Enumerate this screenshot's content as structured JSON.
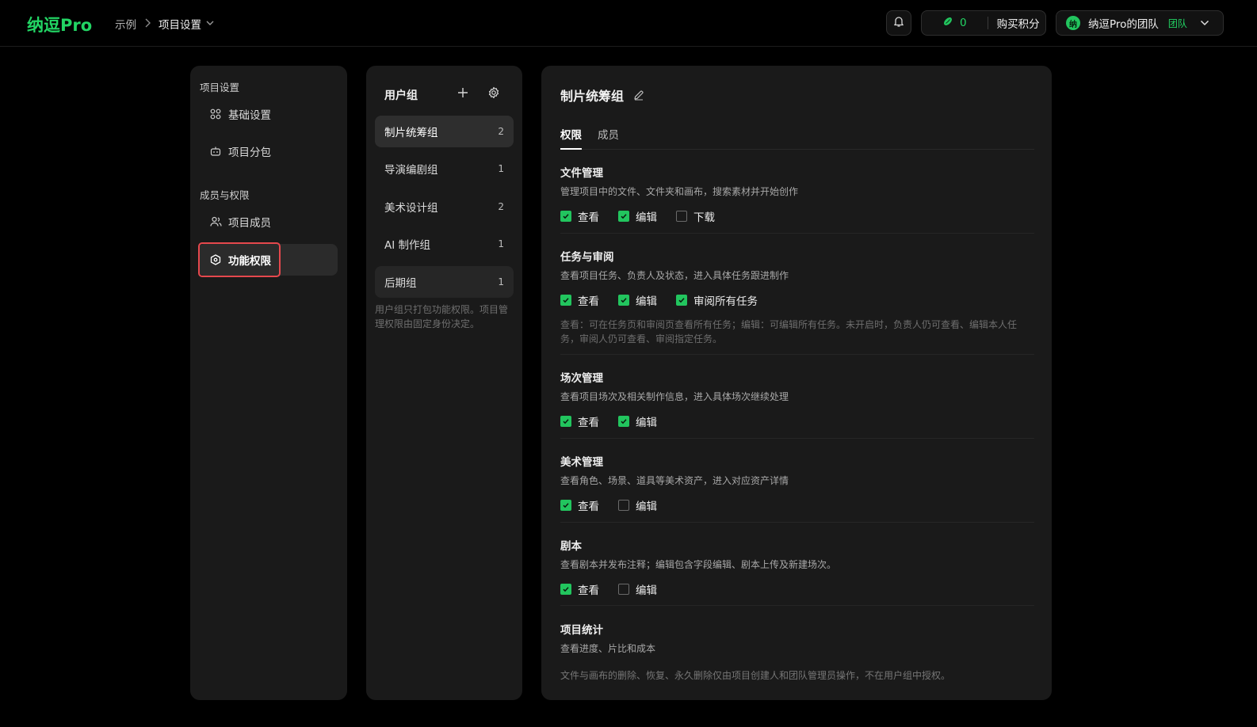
{
  "app": {
    "logo": "纳逗Pro"
  },
  "breadcrumb": {
    "root": "示例",
    "current": "项目设置"
  },
  "header": {
    "points_value": "0",
    "buy_label": "购买积分",
    "team_avatar": "纳",
    "team_name": "纳逗Pro的团队",
    "team_badge": "团队"
  },
  "sidebar": {
    "section1": "项目设置",
    "section2": "成员与权限",
    "items": [
      {
        "label": "基础设置",
        "icon": "grid-icon"
      },
      {
        "label": "项目分包",
        "icon": "robot-icon"
      },
      {
        "label": "项目成员",
        "icon": "users-icon"
      },
      {
        "label": "功能权限",
        "icon": "hexagon-icon"
      }
    ]
  },
  "groups": {
    "title": "用户组",
    "items": [
      {
        "name": "制片统筹组",
        "count": "2"
      },
      {
        "name": "导演编剧组",
        "count": "1"
      },
      {
        "name": "美术设计组",
        "count": "2"
      },
      {
        "name": "AI 制作组",
        "count": "1"
      },
      {
        "name": "后期组",
        "count": "1"
      }
    ],
    "note": "用户组只打包功能权限。项目管理权限由固定身份决定。"
  },
  "permissions": {
    "group_title": "制片统筹组",
    "tabs": [
      "权限",
      "成员"
    ],
    "sections": [
      {
        "title": "文件管理",
        "desc": "管理项目中的文件、文件夹和画布，搜索素材并开始创作",
        "options": [
          {
            "label": "查看",
            "checked": true
          },
          {
            "label": "编辑",
            "checked": true
          },
          {
            "label": "下载",
            "checked": false
          }
        ]
      },
      {
        "title": "任务与审阅",
        "desc": "查看项目任务、负责人及状态，进入具体任务跟进制作",
        "options": [
          {
            "label": "查看",
            "checked": true
          },
          {
            "label": "编辑",
            "checked": true
          },
          {
            "label": "审阅所有任务",
            "checked": true
          }
        ],
        "note": "查看：可在任务页和审阅页查看所有任务；编辑：可编辑所有任务。未开启时，负责人仍可查看、编辑本人任务，审阅人仍可查看、审阅指定任务。"
      },
      {
        "title": "场次管理",
        "desc": "查看项目场次及相关制作信息，进入具体场次继续处理",
        "options": [
          {
            "label": "查看",
            "checked": true
          },
          {
            "label": "编辑",
            "checked": true
          }
        ]
      },
      {
        "title": "美术管理",
        "desc": "查看角色、场景、道具等美术资产，进入对应资产详情",
        "options": [
          {
            "label": "查看",
            "checked": true
          },
          {
            "label": "编辑",
            "checked": false
          }
        ]
      },
      {
        "title": "剧本",
        "desc": "查看剧本并发布注释；编辑包含字段编辑、剧本上传及新建场次。",
        "options": [
          {
            "label": "查看",
            "checked": true
          },
          {
            "label": "编辑",
            "checked": false
          }
        ]
      },
      {
        "title": "项目统计",
        "desc": "查看进度、片比和成本"
      }
    ],
    "footer_note": "文件与画布的删除、恢复、永久删除仅由项目创建人和团队管理员操作，不在用户组中授权。"
  },
  "colors": {
    "accent": "#22c55e",
    "highlight": "#e5484d",
    "panel": "#1a1a1a"
  }
}
